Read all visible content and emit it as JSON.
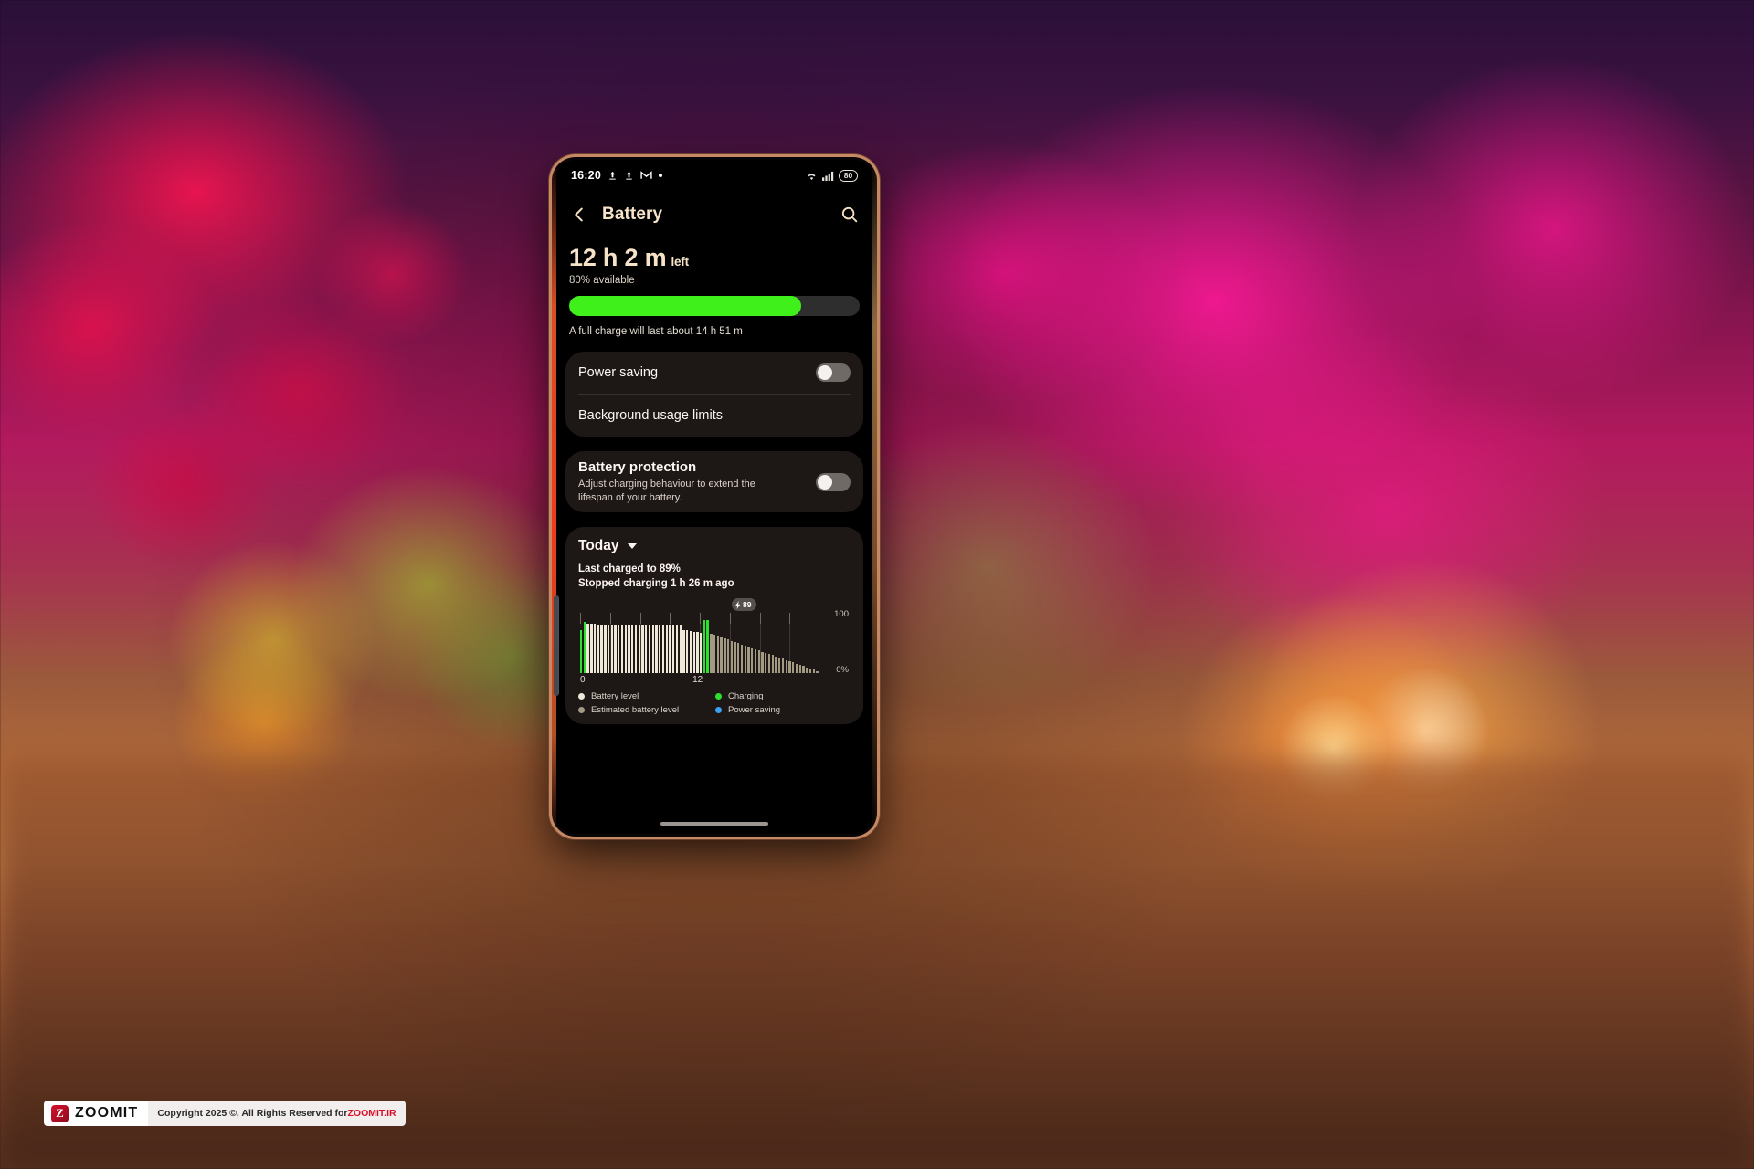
{
  "statusbar": {
    "time": "16:20",
    "icons": [
      "upload-icon",
      "upload-icon",
      "gmail-icon",
      "dot-icon"
    ],
    "wifi_icon": "wifi-icon",
    "signal_icon": "cellular-signal-icon",
    "battery_percent": "80"
  },
  "appbar": {
    "back_icon": "back-arrow-icon",
    "title": "Battery",
    "search_icon": "search-icon"
  },
  "summary": {
    "time_left": "12 h 2 m",
    "time_left_suffix": "left",
    "available": "80% available",
    "battery_percent": 80,
    "fill_color": "#3ff01a",
    "track_color": "#2e2e2e",
    "full_charge_note": "A full charge will last about 14 h 51 m"
  },
  "settings_card": {
    "power_saving_label": "Power saving",
    "power_saving_on": false,
    "background_usage_label": "Background usage limits"
  },
  "protection_card": {
    "title": "Battery protection",
    "subtitle": "Adjust charging behaviour to extend the lifespan of your battery.",
    "toggle_on": false
  },
  "today_card": {
    "header_label": "Today",
    "caret_icon": "chevron-down-icon",
    "last_charged": "Last charged to 89%",
    "stopped_charging": "Stopped charging 1 h 26 m ago",
    "badge_icon": "charging-bolt-icon",
    "badge_value": "89",
    "legend": [
      {
        "label": "Battery level",
        "color": "#efe7d8",
        "name": "legend-battery-level"
      },
      {
        "label": "Estimated battery level",
        "color": "#a39a84",
        "name": "legend-estimated-battery-level"
      },
      {
        "label": "Charging",
        "color": "#2ee02e",
        "name": "legend-charging"
      },
      {
        "label": "Power saving",
        "color": "#3aa0f0",
        "name": "legend-power-saving"
      }
    ]
  },
  "chart_data": {
    "type": "bar",
    "title": "Today battery level",
    "xlabel": "",
    "ylabel": "",
    "x": [
      0,
      12
    ],
    "xtick_labels": [
      "0",
      "12"
    ],
    "ytick_labels": [
      "100",
      "0%"
    ],
    "ylim": [
      0,
      100
    ],
    "grid": true,
    "legend_position": "bottom",
    "series": [
      {
        "name": "Battery level",
        "color": "#efe7d8",
        "values": [
          72,
          86,
          82,
          82,
          82,
          81,
          81,
          81,
          81,
          80,
          80,
          80,
          80,
          80,
          80,
          80,
          80,
          80,
          80,
          80,
          80,
          80,
          80,
          80,
          80,
          80,
          80,
          80,
          80,
          80,
          72,
          71,
          70,
          69,
          68,
          67,
          89,
          89,
          66,
          64,
          62,
          60,
          58,
          56,
          54,
          52,
          50,
          48,
          46,
          44,
          42,
          40,
          38,
          36,
          34,
          32,
          30,
          28,
          26,
          24,
          22,
          20,
          18,
          16,
          14,
          12,
          10,
          8,
          6,
          4
        ],
        "charging_indices": [
          0,
          1,
          36,
          37
        ],
        "charging_color": "#2ee02e",
        "estimated_from_index": 38,
        "estimated_color": "#a39a84"
      }
    ]
  },
  "watermark": {
    "mark": "Z",
    "brand": "ZOOMIT",
    "copyright_prefix": "Copyright 2025 ©, All Rights Reserved for ",
    "copyright_brand": "ZOOMIT.IR"
  },
  "home_indicator": "home-indicator"
}
